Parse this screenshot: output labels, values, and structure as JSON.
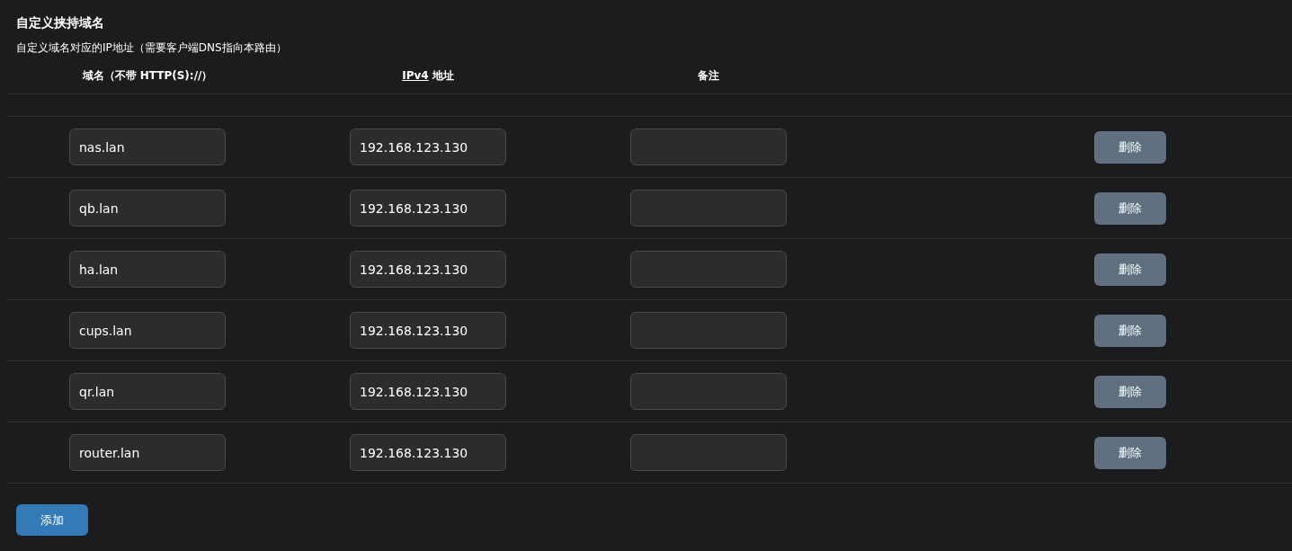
{
  "section": {
    "title": "自定义挟持域名",
    "description": "自定义域名对应的IP地址（需要客户端DNS指向本路由）"
  },
  "table": {
    "columns": [
      {
        "label": "域名（不带 HTTP(S)://）"
      },
      {
        "abbr": "IPv4",
        "label": "地址"
      },
      {
        "label": "备注"
      }
    ],
    "rows": [
      {
        "domain": "nas.lan",
        "ip": "192.168.123.130",
        "note": "",
        "action": "删除"
      },
      {
        "domain": "qb.lan",
        "ip": "192.168.123.130",
        "note": "",
        "action": "删除"
      },
      {
        "domain": "ha.lan",
        "ip": "192.168.123.130",
        "note": "",
        "action": "删除"
      },
      {
        "domain": "cups.lan",
        "ip": "192.168.123.130",
        "note": "",
        "action": "删除"
      },
      {
        "domain": "qr.lan",
        "ip": "192.168.123.130",
        "note": "",
        "action": "删除"
      },
      {
        "domain": "router.lan",
        "ip": "192.168.123.130",
        "note": "",
        "action": "删除"
      }
    ]
  },
  "add_button": "添加"
}
